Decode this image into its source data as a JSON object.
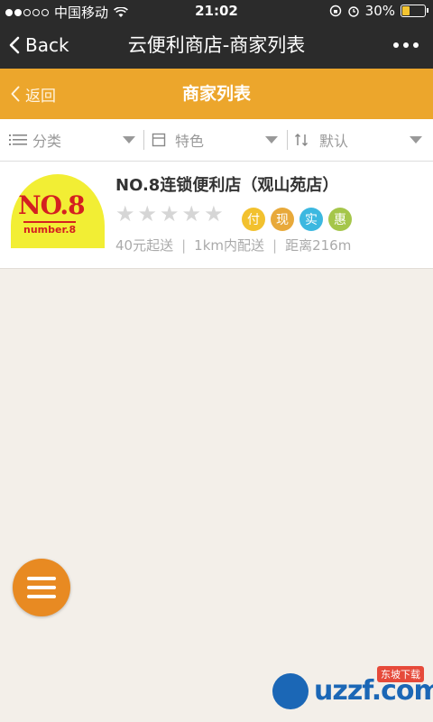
{
  "status_bar": {
    "carrier": "中国移动",
    "time": "21:02",
    "battery": "30%",
    "battery_level": 0.3,
    "signal_icons": [
      "signal-dots-icon",
      "wifi-icon",
      "orientation-lock-icon",
      "alarm-icon",
      "battery-icon"
    ]
  },
  "nav": {
    "back_label": "Back",
    "title": "云便利商店-商家列表"
  },
  "header": {
    "back_label": "返回",
    "title": "商家列表"
  },
  "filters": [
    {
      "label": "分类",
      "icon": "list-icon"
    },
    {
      "label": "特色",
      "icon": "tag-icon"
    },
    {
      "label": "默认",
      "icon": "sort-icon"
    }
  ],
  "store": {
    "logo_text_big": "NO.8",
    "logo_text_small": "number.8",
    "name": "NO.8连锁便利店（观山苑店）",
    "rating": 0,
    "rating_max": 5,
    "badges": [
      {
        "text": "付",
        "color": "#f2c12e"
      },
      {
        "text": "现",
        "color": "#e8a93a"
      },
      {
        "text": "实",
        "color": "#3cb8e0"
      },
      {
        "text": "惠",
        "color": "#a5c64a"
      }
    ],
    "min_order": "40元起送",
    "delivery_range": "1km内配送",
    "distance": "距离216m"
  },
  "watermark": {
    "text": "uzzf.com",
    "tag": "东坡下载"
  },
  "colors": {
    "header_orange": "#eca62c",
    "nav_dark": "#2b2b2b",
    "fab_orange": "#e88a22",
    "background": "#f3efe9"
  }
}
